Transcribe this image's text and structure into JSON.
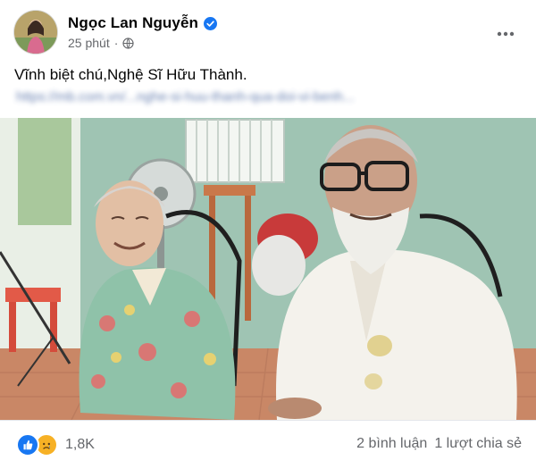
{
  "post": {
    "author": "Ngọc Lan Nguyễn",
    "timestamp": "25 phút",
    "privacy_icon": "globe-icon",
    "caption": "Vĩnh biệt chú,Nghệ Sĩ Hữu Thành.",
    "link_preview_blurred": "https://mb.com.vn/...nghe-si-huu-thanh-qua-doi-vi-benh...",
    "more_icon": "more-horizontal-icon"
  },
  "footer": {
    "reaction_icons": [
      "like-icon",
      "sad-icon"
    ],
    "reaction_count": "1,8K",
    "comments": "2 bình luận",
    "shares": "1 lượt chia sẻ"
  },
  "colors": {
    "brand_blue": "#1877f2",
    "secondary_text": "#65676b",
    "sad_yellow": "#f7b125"
  }
}
